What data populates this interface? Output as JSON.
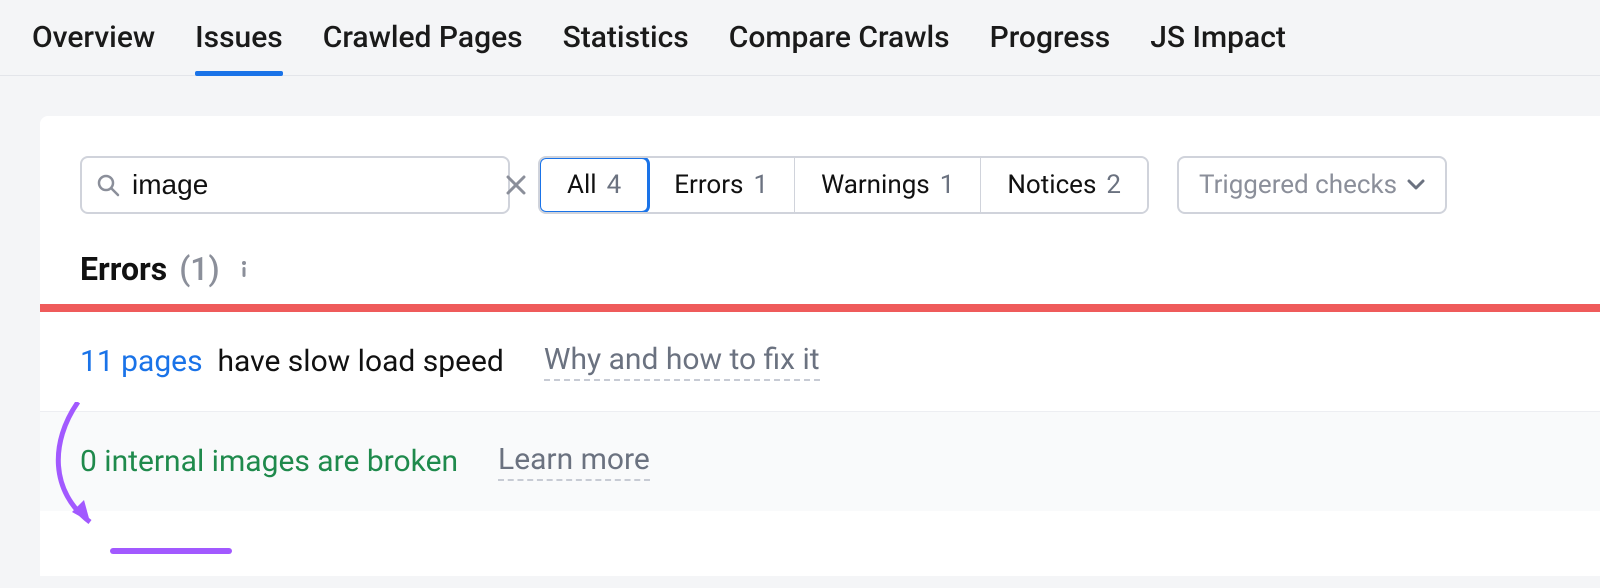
{
  "tabs": [
    {
      "label": "Overview",
      "active": false
    },
    {
      "label": "Issues",
      "active": true
    },
    {
      "label": "Crawled Pages",
      "active": false
    },
    {
      "label": "Statistics",
      "active": false
    },
    {
      "label": "Compare Crawls",
      "active": false
    },
    {
      "label": "Progress",
      "active": false
    },
    {
      "label": "JS Impact",
      "active": false
    }
  ],
  "search": {
    "value": "image"
  },
  "filters": {
    "all": {
      "label": "All",
      "count": "4",
      "selected": true
    },
    "errors": {
      "label": "Errors",
      "count": "1",
      "selected": false
    },
    "warnings": {
      "label": "Warnings",
      "count": "1",
      "selected": false
    },
    "notices": {
      "label": "Notices",
      "count": "2",
      "selected": false
    }
  },
  "dropdown": {
    "label": "Triggered checks"
  },
  "section": {
    "title": "Errors",
    "count": "(1)"
  },
  "issues": [
    {
      "count_link": "11 pages",
      "desc": "have slow load speed",
      "why": "Why and how to fix it",
      "link_class": "blue"
    },
    {
      "count_link": "0 internal images are broken",
      "desc": "",
      "why": "Learn more",
      "link_class": "green"
    }
  ]
}
